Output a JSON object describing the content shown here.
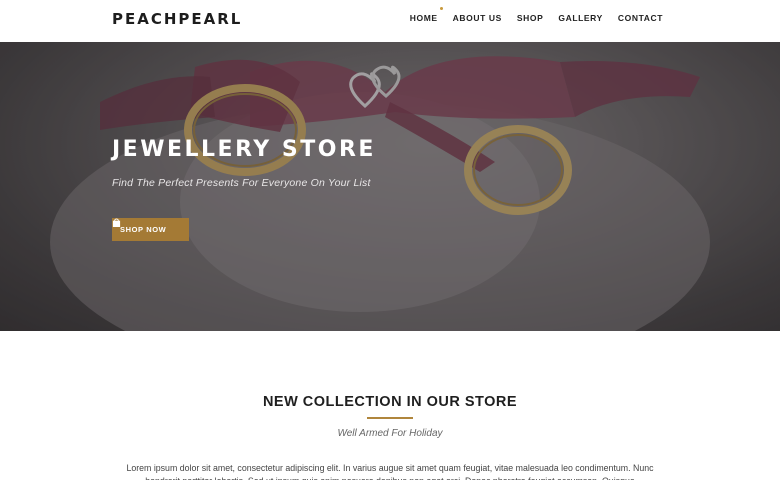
{
  "header": {
    "logo": "PEACHPEARL",
    "nav": [
      "HOME",
      "ABOUT US",
      "SHOP",
      "GALLERY",
      "CONTACT"
    ],
    "active_nav": "HOME"
  },
  "hero": {
    "title": "JEWELLERY STORE",
    "subtitle": "Find The Perfect Presents For Everyone On Your List",
    "button_label": "SHOP NOW",
    "button_icon": "shopping-bag-icon"
  },
  "collection": {
    "title": "NEW COLLECTION IN OUR STORE",
    "subtitle": "Well Armed For Holiday",
    "body": "Lorem ipsum dolor sit amet, consectetur adipiscing elit. In varius augue sit amet quam feugiat, vitae malesuada leo condimentum. Nunc hendrerit porttitor lobortis. Sed ut ipsum quis enim posuere dapibus non eget orci. Donec pharetra feugiat accumsan. Quisque"
  },
  "colors": {
    "accent": "#a47a35",
    "rule": "#b0863c",
    "nav_dot": "#c99a3c",
    "ribbon": "#8a4a5e"
  }
}
